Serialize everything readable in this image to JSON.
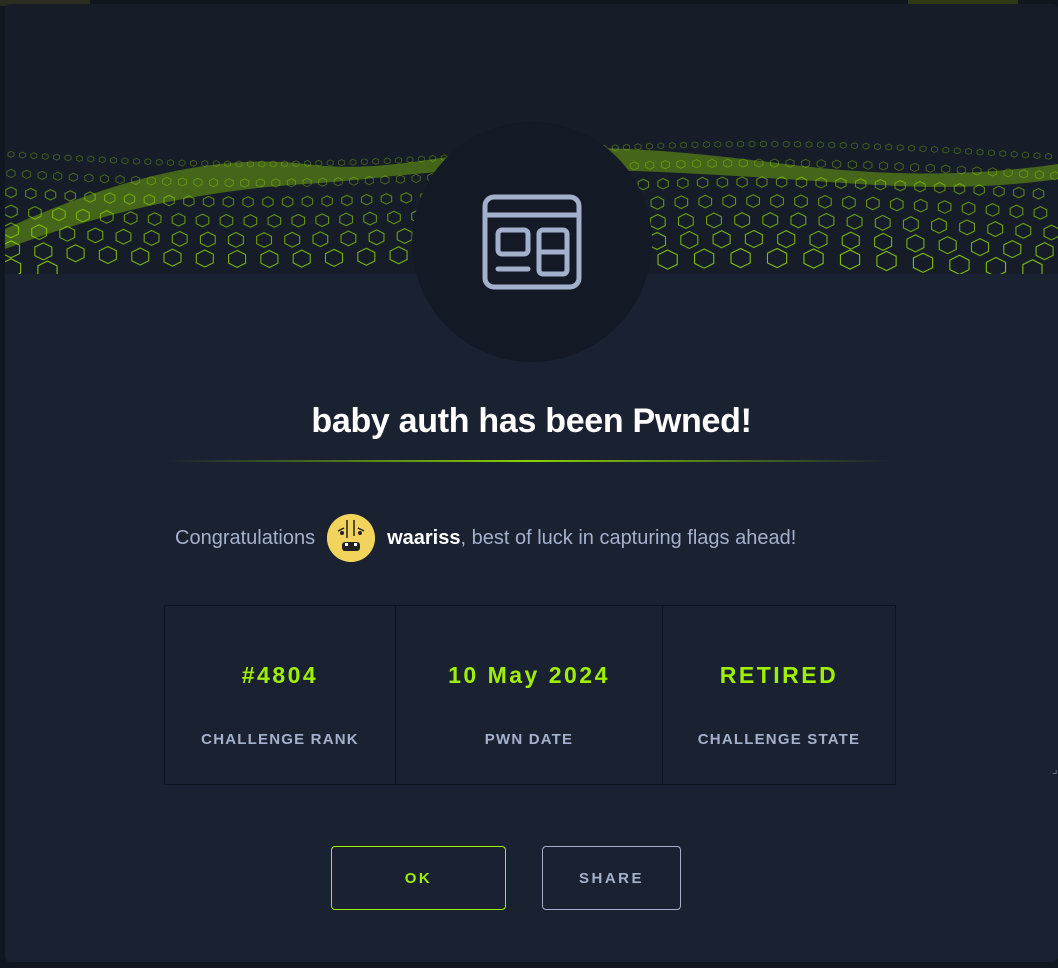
{
  "title": "baby auth has been Pwned!",
  "congrats": {
    "prefix": "Congratulations",
    "username": "waariss",
    "suffix": ", best of luck in capturing flags ahead!"
  },
  "stats": [
    {
      "value": "#4804",
      "label": "CHALLENGE RANK"
    },
    {
      "value": "10 May 2024",
      "label": "PWN DATE"
    },
    {
      "value": "RETIRED",
      "label": "CHALLENGE STATE"
    }
  ],
  "buttons": {
    "ok": "OK",
    "share": "SHARE"
  },
  "icons": {
    "challenge": "web-app-window-icon",
    "avatar": "user-avatar"
  },
  "colors": {
    "accent": "#9fef00",
    "modal_bg": "#1a2231",
    "text_muted": "#a4b1cd",
    "title": "#ffffff"
  }
}
